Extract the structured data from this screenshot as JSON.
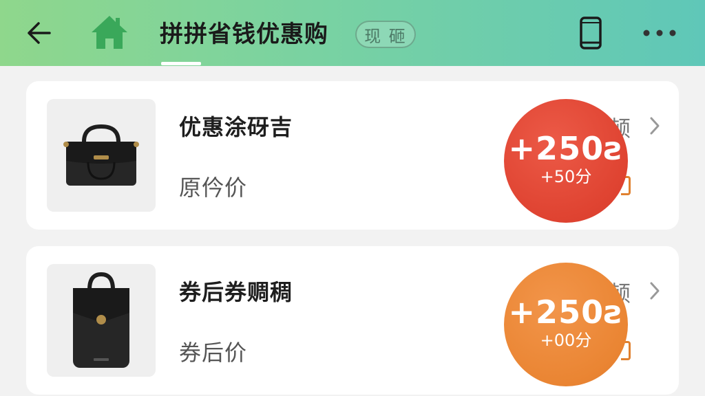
{
  "header": {
    "title": "拼拼省钱优惠购",
    "badge": "现 砸",
    "icons": {
      "back": "arrow-left-icon",
      "home": "home-icon",
      "device": "phone-icon",
      "more": "more-horizontal-icon"
    }
  },
  "products": [
    {
      "name": "优惠涂砑吉",
      "price_label": "原仱价",
      "side_text": "顿",
      "reward_main": "+250ƨ",
      "reward_sub": "+50分",
      "reward_color": "#df4331"
    },
    {
      "name": "券后券赒稠",
      "price_label": "券后价",
      "side_text": "顿",
      "reward_main": "+250ƨ",
      "reward_sub": "+00分",
      "reward_color": "#ea8533"
    }
  ],
  "colors": {
    "header_start": "#8fd78c",
    "header_end": "#5fc7b8",
    "home_icon": "#3aa85a",
    "accent_orange": "#e0802f"
  }
}
